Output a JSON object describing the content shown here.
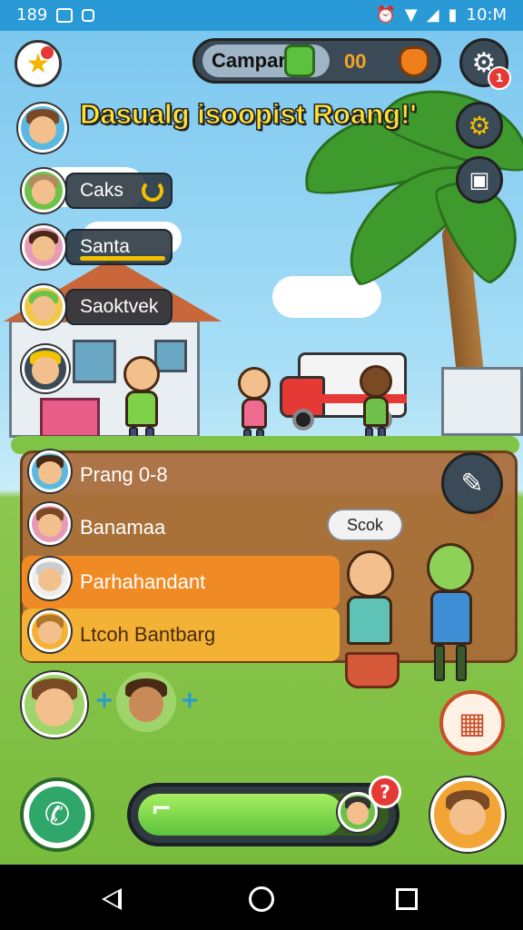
{
  "status_bar": {
    "left_text": "189",
    "time": "10:M"
  },
  "hud": {
    "currency_label": "Campar",
    "currency_value": "00",
    "settings_badge": "1"
  },
  "headline": "Dasualg isoopist Roang!'",
  "friends_top": [
    {
      "name": "Caks"
    },
    {
      "name": "Santa"
    },
    {
      "name": "Saoktvek"
    }
  ],
  "panel_list": [
    {
      "name": "Prang 0-8"
    },
    {
      "name": "Banamaa"
    },
    {
      "name": "Parhahandant"
    },
    {
      "name": "Ltcoh Bantbarg"
    }
  ],
  "score_button": "Scok",
  "progress": {
    "fraction": 0.82
  },
  "question_badge": "?",
  "icons": {
    "star": "star-icon",
    "gear": "gear-icon",
    "camera": "camera-icon",
    "edit": "edit-icon",
    "chat": "chat-icon",
    "phone": "phone-icon"
  },
  "colors": {
    "accent_yellow": "#ffe233",
    "progress_green": "#5cc13c",
    "alert_red": "#e53935",
    "panel_brown": "#aa6937"
  }
}
